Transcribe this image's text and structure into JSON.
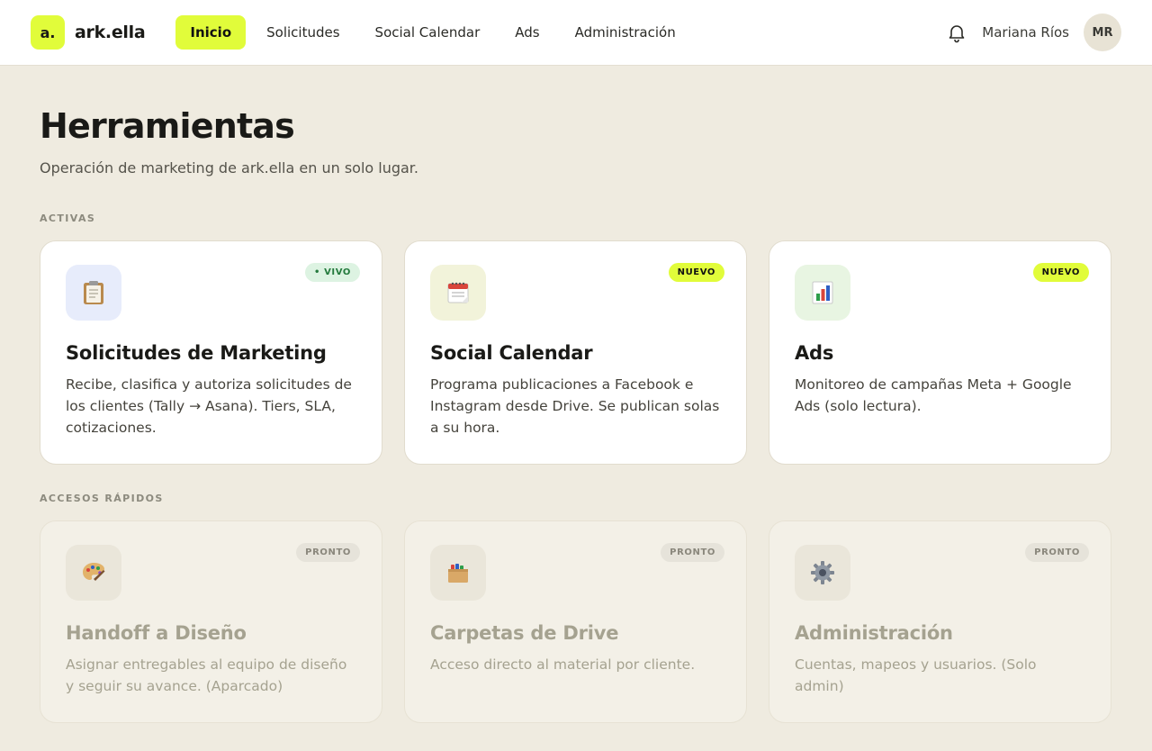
{
  "brand": {
    "logo_mark": "a.",
    "name": "ark.ella",
    "accent": "#E1FC3A"
  },
  "nav": {
    "items": [
      {
        "label": "Inicio",
        "active": true
      },
      {
        "label": "Solicitudes",
        "active": false
      },
      {
        "label": "Social Calendar",
        "active": false
      },
      {
        "label": "Ads",
        "active": false
      },
      {
        "label": "Administración",
        "active": false
      }
    ]
  },
  "user": {
    "name": "Mariana Ríos",
    "initials": "MR",
    "notification_icon": "bell-icon"
  },
  "page": {
    "title": "Herramientas",
    "subtitle": "Operación de marketing de ark.ella en un solo lugar."
  },
  "sections": {
    "active": {
      "label": "ACTIVAS",
      "cards": [
        {
          "icon": "clipboard-icon",
          "badge": "• VIVO",
          "title": "Solicitudes de Marketing",
          "description": "Recibe, clasifica y autoriza solicitudes de los clientes (Tally → Asana). Tiers, SLA, cotizaciones."
        },
        {
          "icon": "calendar-icon",
          "badge": "NUEVO",
          "title": "Social Calendar",
          "description": "Programa publicaciones a Facebook e Instagram desde Drive. Se publican solas a su hora."
        },
        {
          "icon": "bar-chart-icon",
          "badge": "NUEVO",
          "title": "Ads",
          "description": "Monitoreo de campañas Meta + Google Ads (solo lectura)."
        }
      ]
    },
    "quick": {
      "label": "ACCESOS RÁPIDOS",
      "cards": [
        {
          "icon": "palette-icon",
          "badge": "PRONTO",
          "title": "Handoff a Diseño",
          "description": "Asignar entregables al equipo de diseño y seguir su avance. (Aparcado)"
        },
        {
          "icon": "folder-box-icon",
          "badge": "PRONTO",
          "title": "Carpetas de Drive",
          "description": "Acceso directo al material por cliente."
        },
        {
          "icon": "gear-icon",
          "badge": "PRONTO",
          "title": "Administración",
          "description": "Cuentas, mapeos y usuarios. (Solo admin)"
        }
      ]
    }
  }
}
